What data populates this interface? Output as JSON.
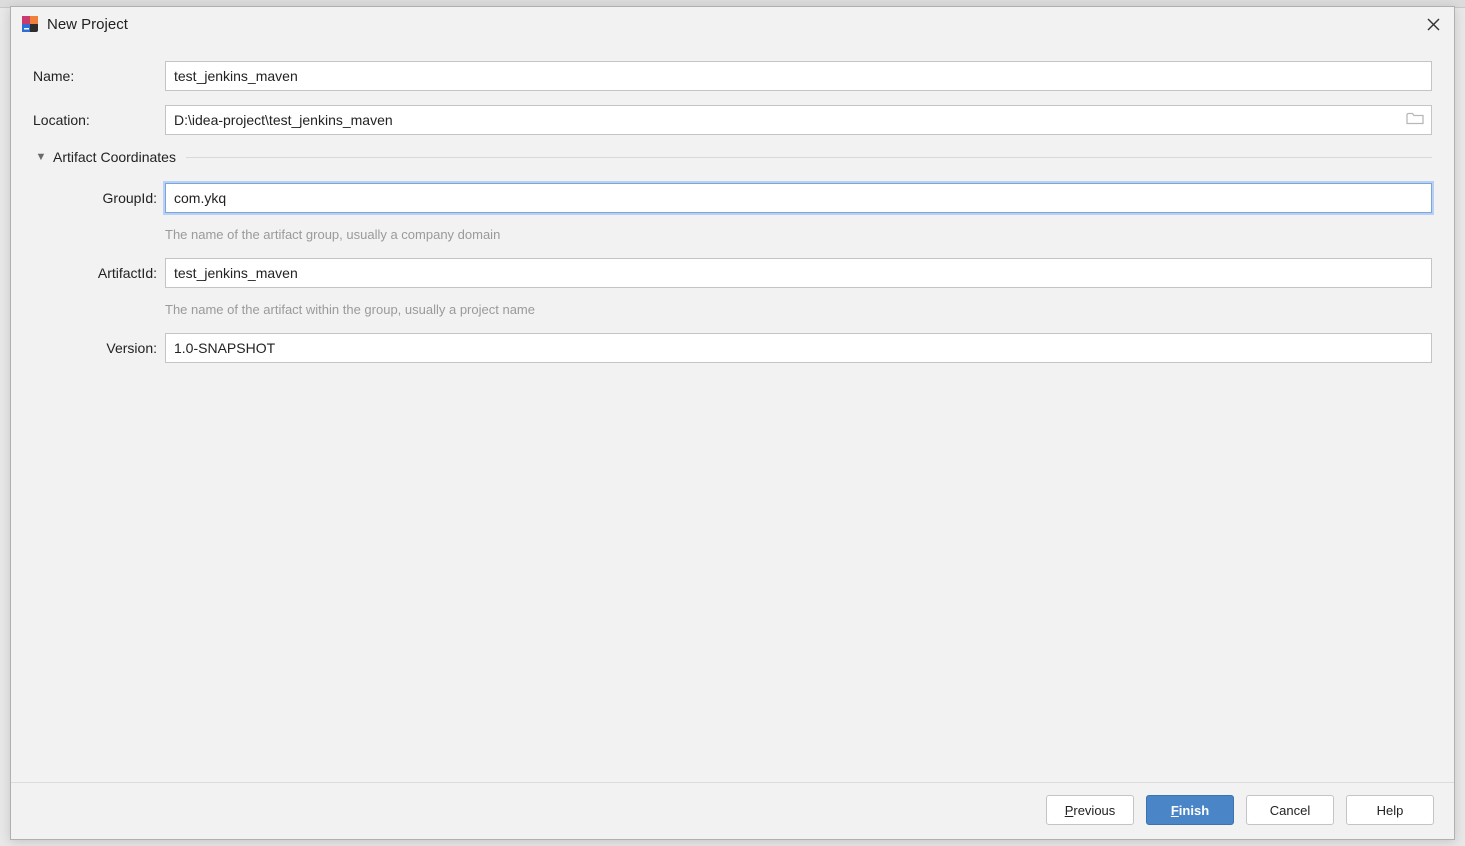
{
  "dialog": {
    "title": "New Project",
    "fields": {
      "name_label": "Name:",
      "name_value": "test_jenkins_maven",
      "location_label": "Location:",
      "location_value": "D:\\idea-project\\test_jenkins_maven"
    },
    "section": {
      "title": "Artifact Coordinates",
      "groupid_label": "GroupId:",
      "groupid_value": "com.ykq",
      "groupid_hint": "The name of the artifact group, usually a company domain",
      "artifactid_label": "ArtifactId:",
      "artifactid_value": "test_jenkins_maven",
      "artifactid_hint": "The name of the artifact within the group, usually a project name",
      "version_label": "Version:",
      "version_value": "1.0-SNAPSHOT"
    },
    "buttons": {
      "previous": "Previous",
      "finish": "Finish",
      "cancel": "Cancel",
      "help": "Help"
    }
  }
}
